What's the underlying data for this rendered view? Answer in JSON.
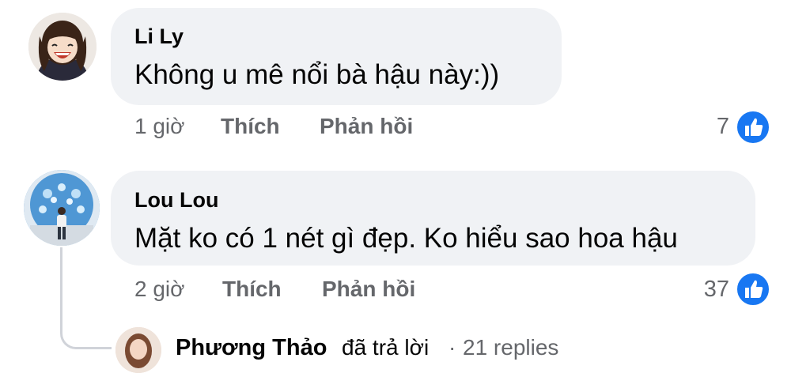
{
  "colors": {
    "bubble": "#f0f2f5",
    "meta": "#65676b",
    "like": "#1877f2",
    "name": "#050505"
  },
  "comments": [
    {
      "author": "Li Ly",
      "text": "Không u mê nổi bà hậu này:))",
      "time": "1 giờ",
      "like_label": "Thích",
      "reply_label": "Phản hồi",
      "reaction_count": "7",
      "reaction_icon": "thumbs-up-icon"
    },
    {
      "author": "Lou Lou",
      "text": "Mặt ko có 1 nét gì đẹp. Ko hiểu sao hoa hậu",
      "time": "2 giờ",
      "like_label": "Thích",
      "reply_label": "Phản hồi",
      "reaction_count": "37",
      "reaction_icon": "thumbs-up-icon"
    }
  ],
  "reply_summary": {
    "author": "Phương Thảo",
    "action": "đã trả lời",
    "separator": "·",
    "count_text": "21 replies"
  }
}
